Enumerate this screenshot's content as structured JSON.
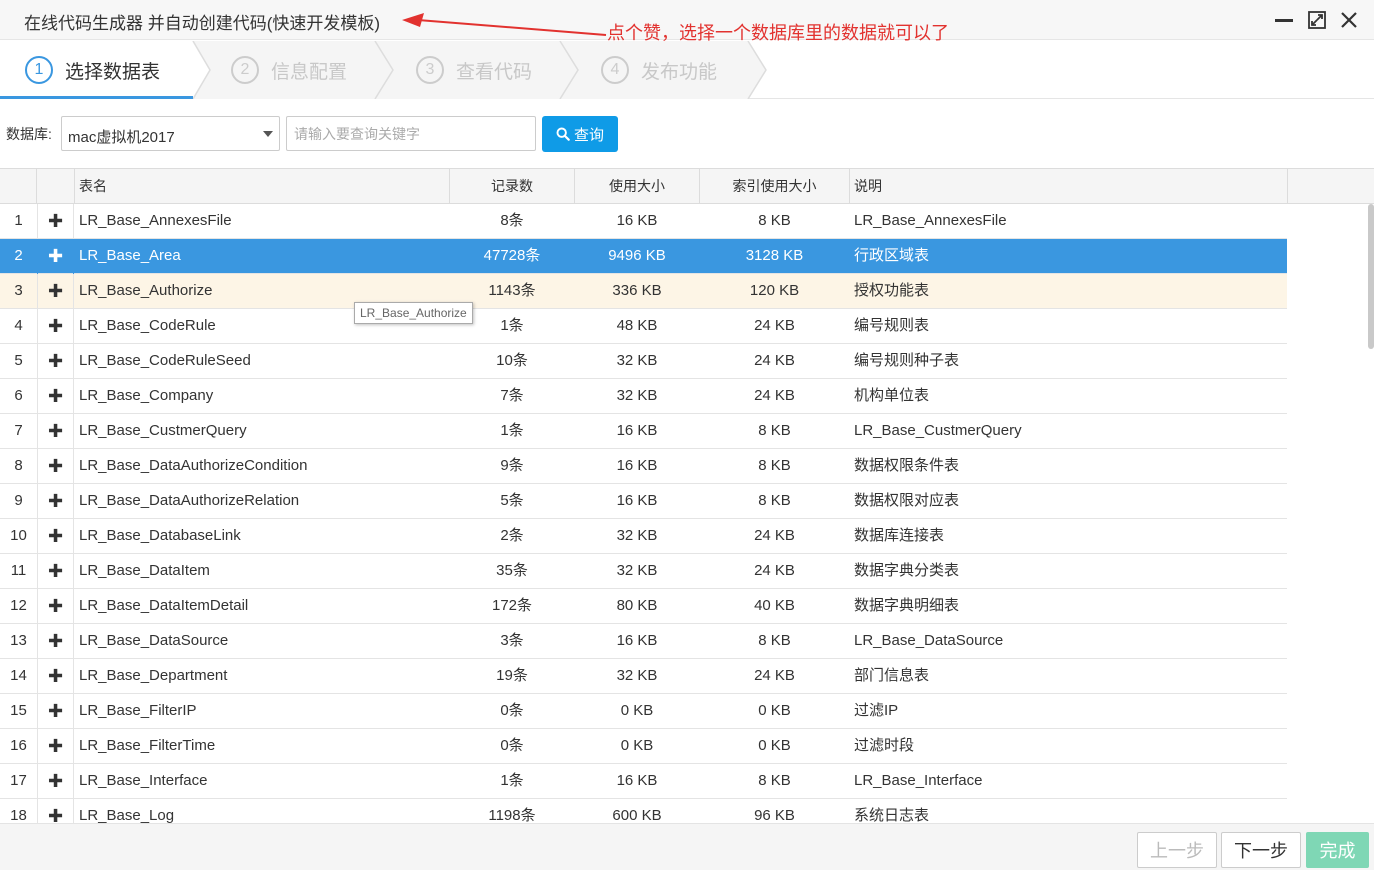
{
  "window": {
    "title": "在线代码生成器 并自动创建代码(快速开发模板)",
    "annotation": "点个赞，选择一个数据库里的数据就可以了"
  },
  "steps": [
    {
      "num": "1",
      "label": "选择数据表",
      "active": true
    },
    {
      "num": "2",
      "label": "信息配置",
      "active": false
    },
    {
      "num": "3",
      "label": "查看代码",
      "active": false
    },
    {
      "num": "4",
      "label": "发布功能",
      "active": false
    }
  ],
  "toolbar": {
    "db_label": "数据库:",
    "db_value": "mac虚拟机2017",
    "search_placeholder": "请输入要查询关键字",
    "search_button": "查询"
  },
  "table": {
    "columns": [
      "表名",
      "记录数",
      "使用大小",
      "索引使用大小",
      "说明"
    ],
    "rows": [
      {
        "num": "1",
        "name": "LR_Base_AnnexesFile",
        "records": "8条",
        "size": "16 KB",
        "index_size": "8 KB",
        "desc": "LR_Base_AnnexesFile"
      },
      {
        "num": "2",
        "name": "LR_Base_Area",
        "records": "47728条",
        "size": "9496 KB",
        "index_size": "3128 KB",
        "desc": "行政区域表"
      },
      {
        "num": "3",
        "name": "LR_Base_Authorize",
        "records": "1143条",
        "size": "336 KB",
        "index_size": "120 KB",
        "desc": "授权功能表"
      },
      {
        "num": "4",
        "name": "LR_Base_CodeRule",
        "records": "1条",
        "size": "48 KB",
        "index_size": "24 KB",
        "desc": "编号规则表"
      },
      {
        "num": "5",
        "name": "LR_Base_CodeRuleSeed",
        "records": "10条",
        "size": "32 KB",
        "index_size": "24 KB",
        "desc": "编号规则种子表"
      },
      {
        "num": "6",
        "name": "LR_Base_Company",
        "records": "7条",
        "size": "32 KB",
        "index_size": "24 KB",
        "desc": "机构单位表"
      },
      {
        "num": "7",
        "name": "LR_Base_CustmerQuery",
        "records": "1条",
        "size": "16 KB",
        "index_size": "8 KB",
        "desc": "LR_Base_CustmerQuery"
      },
      {
        "num": "8",
        "name": "LR_Base_DataAuthorizeCondition",
        "records": "9条",
        "size": "16 KB",
        "index_size": "8 KB",
        "desc": "数据权限条件表"
      },
      {
        "num": "9",
        "name": "LR_Base_DataAuthorizeRelation",
        "records": "5条",
        "size": "16 KB",
        "index_size": "8 KB",
        "desc": "数据权限对应表"
      },
      {
        "num": "10",
        "name": "LR_Base_DatabaseLink",
        "records": "2条",
        "size": "32 KB",
        "index_size": "24 KB",
        "desc": "数据库连接表"
      },
      {
        "num": "11",
        "name": "LR_Base_DataItem",
        "records": "35条",
        "size": "32 KB",
        "index_size": "24 KB",
        "desc": "数据字典分类表"
      },
      {
        "num": "12",
        "name": "LR_Base_DataItemDetail",
        "records": "172条",
        "size": "80 KB",
        "index_size": "40 KB",
        "desc": "数据字典明细表"
      },
      {
        "num": "13",
        "name": "LR_Base_DataSource",
        "records": "3条",
        "size": "16 KB",
        "index_size": "8 KB",
        "desc": "LR_Base_DataSource"
      },
      {
        "num": "14",
        "name": "LR_Base_Department",
        "records": "19条",
        "size": "32 KB",
        "index_size": "24 KB",
        "desc": "部门信息表"
      },
      {
        "num": "15",
        "name": "LR_Base_FilterIP",
        "records": "0条",
        "size": "0 KB",
        "index_size": "0 KB",
        "desc": "过滤IP"
      },
      {
        "num": "16",
        "name": "LR_Base_FilterTime",
        "records": "0条",
        "size": "0 KB",
        "index_size": "0 KB",
        "desc": "过滤时段"
      },
      {
        "num": "17",
        "name": "LR_Base_Interface",
        "records": "1条",
        "size": "16 KB",
        "index_size": "8 KB",
        "desc": "LR_Base_Interface"
      },
      {
        "num": "18",
        "name": "LR_Base_Log",
        "records": "1198条",
        "size": "600 KB",
        "index_size": "96 KB",
        "desc": "系统日志表"
      }
    ],
    "selected_row": "2",
    "hover_row": "3",
    "tooltip": "LR_Base_Authorize",
    "expand_icon": "plus-icon"
  },
  "footer": {
    "prev": "上一步",
    "next": "下一步",
    "done": "完成"
  },
  "colors": {
    "accent": "#3a97e0",
    "search_button": "#0f9be7",
    "hover_row": "#fdf5e6",
    "done_button": "#7fd7b5",
    "annotation": "#e2322f"
  }
}
